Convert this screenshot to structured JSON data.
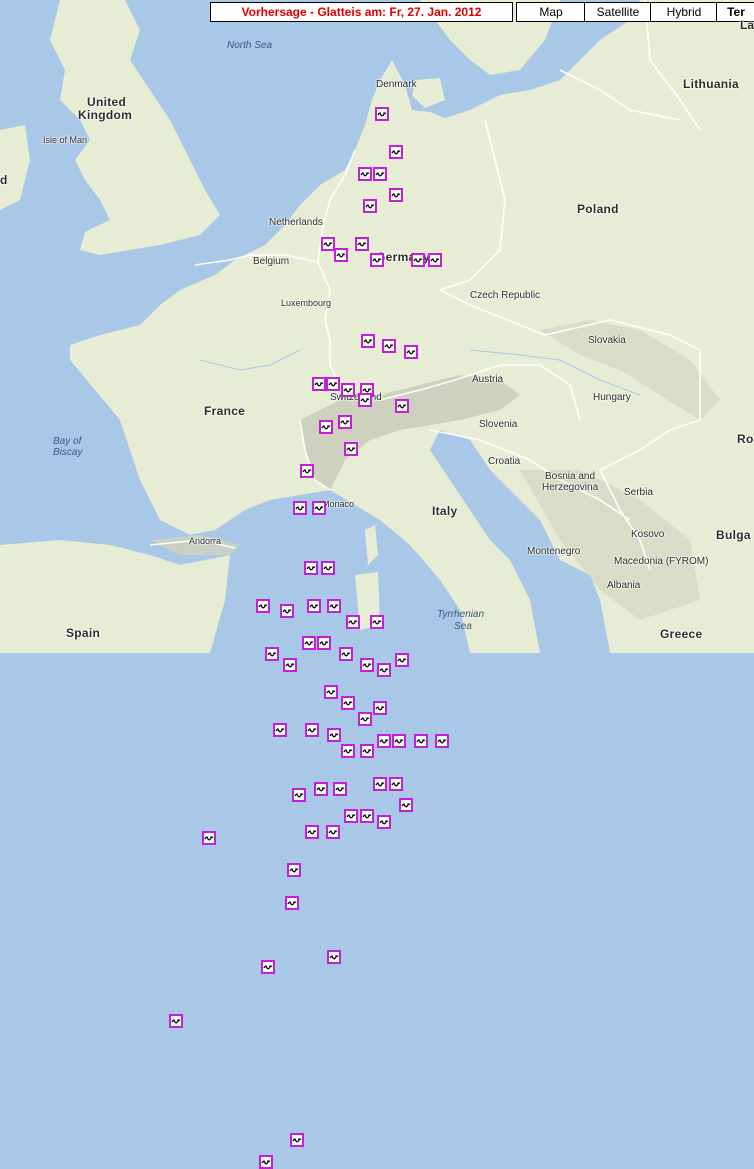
{
  "header": {
    "title": "Vorhersage - Glatteis am: Fr, 27. Jan. 2012"
  },
  "map_type_buttons": [
    {
      "label": "Map",
      "active": false
    },
    {
      "label": "Satellite",
      "active": false
    },
    {
      "label": "Hybrid",
      "active": false
    },
    {
      "label": "Ter",
      "active": true
    }
  ],
  "labels": {
    "north_sea": "North Sea",
    "denmark": "Denmark",
    "lithuania": "Lithuania",
    "united_kingdom_1": "United",
    "united_kingdom_2": "Kingdom",
    "isle_of_man": "Isle of Man",
    "netherlands": "Netherlands",
    "poland": "Poland",
    "belgium": "Belgium",
    "germany": "Germany",
    "luxembourg": "Luxembourg",
    "czech_republic": "Czech Republic",
    "slovakia": "Slovakia",
    "austria": "Austria",
    "hungary": "Hungary",
    "france": "France",
    "switzerland": "Switzerland",
    "bay_of_biscay_1": "Bay of",
    "bay_of_biscay_2": "Biscay",
    "slovenia": "Slovenia",
    "croatia": "Croatia",
    "romania": "Roman",
    "bosnia_1": "Bosnia and",
    "bosnia_2": "Herzegovina",
    "serbia": "Serbia",
    "bulgaria": "Bulga",
    "monaco": "Monaco",
    "italy": "Italy",
    "andorra": "Andorra",
    "kosovo": "Kosovo",
    "montenegro": "Montenegro",
    "macedonia": "Macedonia (FYROM)",
    "albania": "Albania",
    "tyrrhenian_1": "Tyrrhenian",
    "tyrrhenian_2": "Sea",
    "spain": "Spain",
    "greece": "Greece",
    "ireland_frag": "d",
    "top_right_frag": "La"
  },
  "colors": {
    "marker_border": "#c21fd6",
    "title_text": "#e00000",
    "sea": "#a9c7e6",
    "land": "#e7ecd4"
  },
  "marker_icon": "glatteis-warning-icon",
  "markers": [
    {
      "lon": 10.0,
      "lat": 54.1
    },
    {
      "lon": 10.4,
      "lat": 53.75
    },
    {
      "lon": 9.5,
      "lat": 53.55
    },
    {
      "lon": 9.95,
      "lat": 53.55
    },
    {
      "lon": 10.4,
      "lat": 53.35
    },
    {
      "lon": 9.65,
      "lat": 53.25
    },
    {
      "lon": 8.4,
      "lat": 52.9
    },
    {
      "lon": 8.8,
      "lat": 52.8
    },
    {
      "lon": 9.4,
      "lat": 52.9
    },
    {
      "lon": 9.85,
      "lat": 52.75
    },
    {
      "lon": 11.05,
      "lat": 52.75
    },
    {
      "lon": 11.55,
      "lat": 52.75
    },
    {
      "lon": 9.6,
      "lat": 52.0
    },
    {
      "lon": 10.2,
      "lat": 51.95
    },
    {
      "lon": 10.85,
      "lat": 51.9
    },
    {
      "lon": 8.15,
      "lat": 51.6
    },
    {
      "lon": 8.55,
      "lat": 51.6
    },
    {
      "lon": 9.0,
      "lat": 51.55
    },
    {
      "lon": 9.55,
      "lat": 51.55
    },
    {
      "lon": 8.35,
      "lat": 51.2
    },
    {
      "lon": 8.9,
      "lat": 51.25
    },
    {
      "lon": 9.5,
      "lat": 51.45
    },
    {
      "lon": 9.1,
      "lat": 51.0
    },
    {
      "lon": 10.6,
      "lat": 51.4
    },
    {
      "lon": 7.8,
      "lat": 50.8
    },
    {
      "lon": 7.6,
      "lat": 50.45
    },
    {
      "lon": 8.15,
      "lat": 50.45
    },
    {
      "lon": 7.9,
      "lat": 49.9
    },
    {
      "lon": 8.4,
      "lat": 49.9
    },
    {
      "lon": 6.5,
      "lat": 49.55
    },
    {
      "lon": 7.2,
      "lat": 49.5
    },
    {
      "lon": 8.0,
      "lat": 49.55
    },
    {
      "lon": 8.6,
      "lat": 49.55
    },
    {
      "lon": 9.15,
      "lat": 49.4
    },
    {
      "lon": 9.85,
      "lat": 49.4
    },
    {
      "lon": 6.75,
      "lat": 49.1
    },
    {
      "lon": 7.3,
      "lat": 49.0
    },
    {
      "lon": 7.85,
      "lat": 49.2
    },
    {
      "lon": 8.3,
      "lat": 49.2
    },
    {
      "lon": 8.95,
      "lat": 49.1
    },
    {
      "lon": 9.55,
      "lat": 49.0
    },
    {
      "lon": 10.05,
      "lat": 48.95
    },
    {
      "lon": 10.6,
      "lat": 49.05
    },
    {
      "lon": 8.5,
      "lat": 48.75
    },
    {
      "lon": 9.0,
      "lat": 48.65
    },
    {
      "lon": 9.5,
      "lat": 48.5
    },
    {
      "lon": 9.95,
      "lat": 48.6
    },
    {
      "lon": 7.0,
      "lat": 48.4
    },
    {
      "lon": 7.95,
      "lat": 48.4
    },
    {
      "lon": 8.6,
      "lat": 48.35
    },
    {
      "lon": 9.0,
      "lat": 48.2
    },
    {
      "lon": 9.55,
      "lat": 48.2
    },
    {
      "lon": 10.05,
      "lat": 48.3
    },
    {
      "lon": 10.5,
      "lat": 48.3
    },
    {
      "lon": 11.15,
      "lat": 48.3
    },
    {
      "lon": 11.75,
      "lat": 48.3
    },
    {
      "lon": 9.95,
      "lat": 47.9
    },
    {
      "lon": 10.4,
      "lat": 47.9
    },
    {
      "lon": 7.55,
      "lat": 47.8
    },
    {
      "lon": 8.2,
      "lat": 47.85
    },
    {
      "lon": 8.75,
      "lat": 47.85
    },
    {
      "lon": 9.1,
      "lat": 47.6
    },
    {
      "lon": 9.55,
      "lat": 47.6
    },
    {
      "lon": 10.05,
      "lat": 47.55
    },
    {
      "lon": 10.7,
      "lat": 47.7
    },
    {
      "lon": 7.95,
      "lat": 47.45
    },
    {
      "lon": 8.55,
      "lat": 47.45
    },
    {
      "lon": 4.9,
      "lat": 47.4
    },
    {
      "lon": 7.4,
      "lat": 47.1
    },
    {
      "lon": 7.35,
      "lat": 46.8
    },
    {
      "lon": 8.6,
      "lat": 46.3
    },
    {
      "lon": 6.65,
      "lat": 46.2
    },
    {
      "lon": 3.95,
      "lat": 45.7
    },
    {
      "lon": 7.5,
      "lat": 44.6
    },
    {
      "lon": 6.6,
      "lat": 44.4
    }
  ]
}
